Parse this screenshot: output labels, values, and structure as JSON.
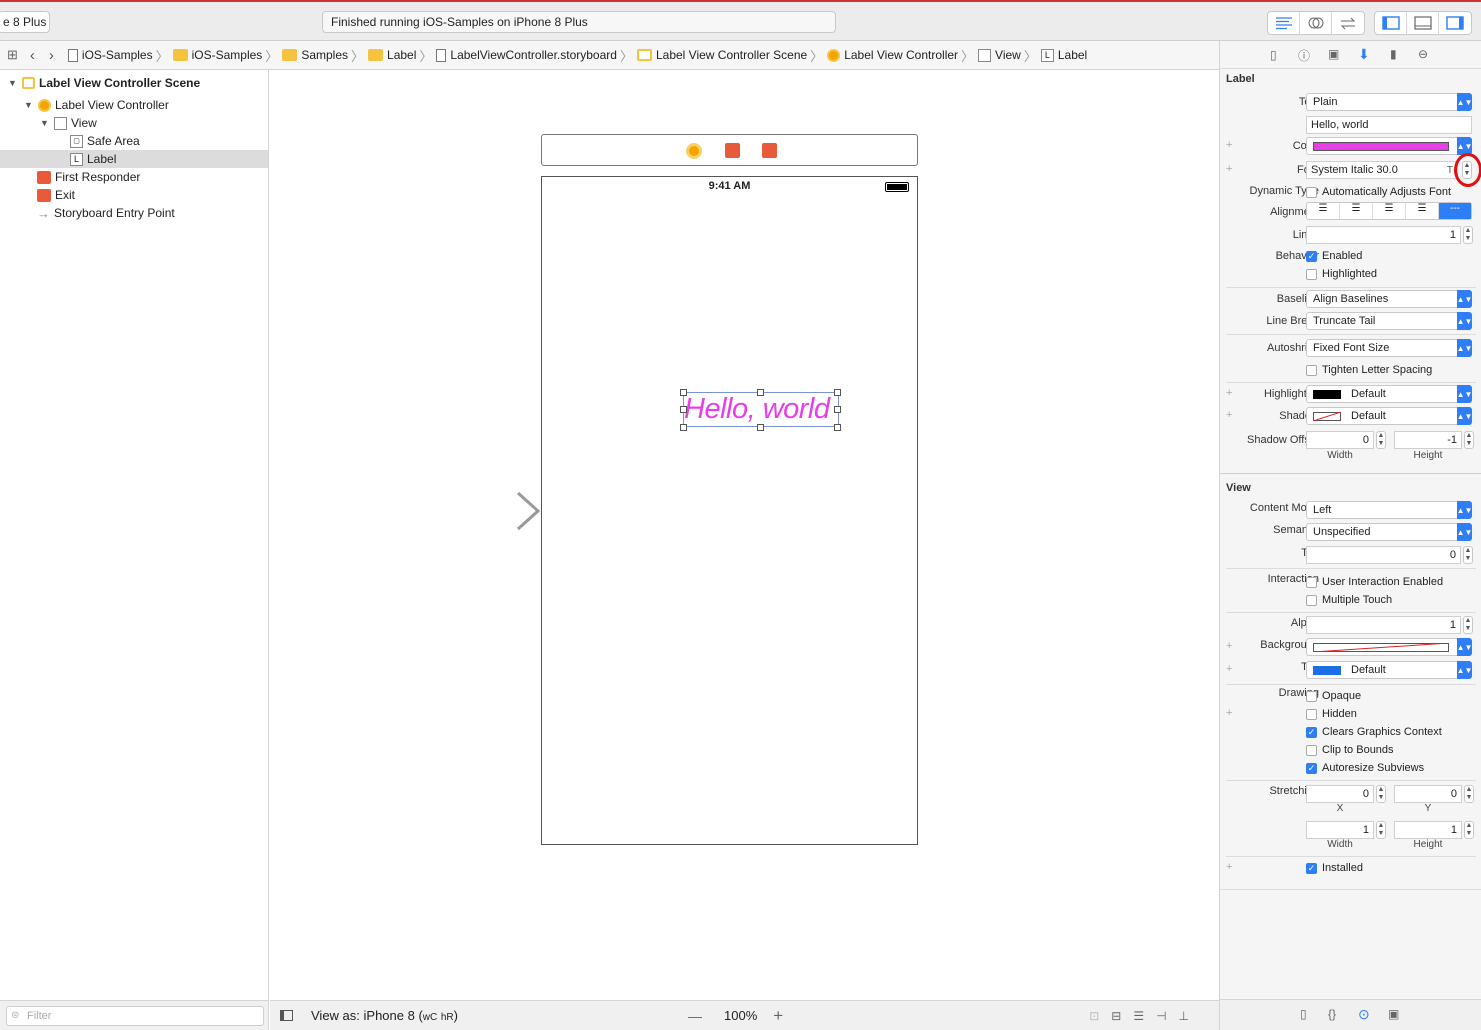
{
  "toolbar": {
    "scheme_label": "e 8 Plus",
    "status_text": "Finished running iOS-Samples on iPhone 8 Plus"
  },
  "jumpbar": {
    "crumbs": [
      "iOS-Samples",
      "iOS-Samples",
      "Samples",
      "Label",
      "LabelViewController.storyboard",
      "Label View Controller Scene",
      "Label View Controller",
      "View",
      "Label"
    ]
  },
  "outline": {
    "items": [
      {
        "label": "Label View Controller Scene"
      },
      {
        "label": "Label View Controller"
      },
      {
        "label": "View"
      },
      {
        "label": "Safe Area"
      },
      {
        "label": "Label"
      },
      {
        "label": "First Responder"
      },
      {
        "label": "Exit"
      },
      {
        "label": "Storyboard Entry Point"
      }
    ],
    "filter_placeholder": "Filter"
  },
  "canvas": {
    "status_time": "9:41 AM",
    "label_text": "Hello, world",
    "label_color": "#e83ee8"
  },
  "bottombar": {
    "view_as": "View as: iPhone 8",
    "size_class_w": "wC",
    "size_class_h": "hR",
    "zoom": "100%",
    "zoom_out": "—",
    "zoom_in": "+"
  },
  "inspector": {
    "label_section": "Label",
    "text_label": "Text",
    "text_type": "Plain",
    "text_value": "Hello, world",
    "color_label": "Color",
    "color_value": "#e83ee8",
    "font_label": "Font",
    "font_value": "System Italic 30.0",
    "dynamic_type_label": "Dynamic Type",
    "dynamic_type_option": "Automatically Adjusts Font",
    "alignment_label": "Alignment",
    "lines_label": "Lines",
    "lines_value": "1",
    "behavior_label": "Behavior",
    "enabled_label": "Enabled",
    "highlighted_cb_label": "Highlighted",
    "baseline_label": "Baseline",
    "baseline_value": "Align Baselines",
    "linebreak_label": "Line Break",
    "linebreak_value": "Truncate Tail",
    "autoshrink_label": "Autoshrink",
    "autoshrink_value": "Fixed Font Size",
    "tighten_label": "Tighten Letter Spacing",
    "highlighted_label": "Highlighted",
    "highlighted_value": "Default",
    "shadow_label": "Shadow",
    "shadow_value": "Default",
    "shadow_offset_label": "Shadow Offset",
    "shadow_w": "0",
    "shadow_h": "-1",
    "width_label": "Width",
    "height_label": "Height",
    "view_section": "View",
    "content_mode_label": "Content Mode",
    "content_mode_value": "Left",
    "semantic_label": "Semantic",
    "semantic_value": "Unspecified",
    "tag_label": "Tag",
    "tag_value": "0",
    "interaction_label": "Interaction",
    "user_interaction": "User Interaction Enabled",
    "multiple_touch": "Multiple Touch",
    "alpha_label": "Alpha",
    "alpha_value": "1",
    "background_label": "Background",
    "tint_label": "Tint",
    "tint_value": "Default",
    "tint_color": "#1a6fe8",
    "drawing_label": "Drawing",
    "opaque": "Opaque",
    "hidden": "Hidden",
    "clears_graphics": "Clears Graphics Context",
    "clip_to_bounds": "Clip to Bounds",
    "autoresize": "Autoresize Subviews",
    "stretching_label": "Stretching",
    "stretch_x": "0",
    "stretch_y": "0",
    "stretch_w": "1",
    "stretch_h": "1",
    "x_label": "X",
    "y_label": "Y",
    "installed": "Installed"
  }
}
